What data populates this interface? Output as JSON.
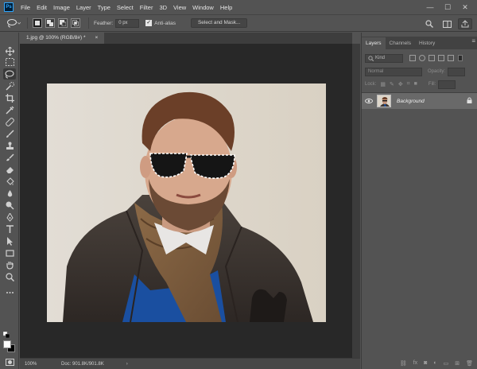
{
  "app": {
    "logo_text": "Ps"
  },
  "menu": [
    "File",
    "Edit",
    "Image",
    "Layer",
    "Type",
    "Select",
    "Filter",
    "3D",
    "View",
    "Window",
    "Help"
  ],
  "window_controls": {
    "minimize": "—",
    "maximize": "☐",
    "close": "✕"
  },
  "options_bar": {
    "tool_icon": "lasso-icon",
    "feather_label": "Feather:",
    "feather_value": "0 px",
    "antialias_label": "Anti-alias",
    "antialias_checked": true,
    "select_mask_label": "Select and Mask..."
  },
  "document": {
    "tab_title": "1.jpg @ 100% (RGB/8#) *",
    "tab_close": "×",
    "zoom": "100%",
    "doc_info": "Doc: 901.8K/901.8K"
  },
  "toolbar": {
    "tools": [
      "move-tool",
      "rect-marquee-tool",
      "lasso-tool",
      "quick-select-tool",
      "crop-tool",
      "eyedropper-tool",
      "healing-tool",
      "brush-tool",
      "clone-stamp-tool",
      "history-brush-tool",
      "eraser-tool",
      "paint-bucket-tool",
      "blur-tool",
      "dodge-tool",
      "pen-tool",
      "type-tool",
      "path-select-tool",
      "rectangle-tool",
      "hand-tool",
      "zoom-tool",
      "more-tools"
    ],
    "active_tool": "lasso-tool",
    "foreground_color": "#ffffff",
    "background_color": "#000000"
  },
  "panels": {
    "tabs": [
      "Layers",
      "Channels",
      "History"
    ],
    "active_tab": "Layers",
    "kind_placeholder": "Kind",
    "blend_mode": "Normal",
    "opacity_label": "Opacity:",
    "lock_label": "Lock:",
    "fill_label": "Fill:",
    "layers": [
      {
        "name": "Background",
        "visible": true,
        "locked": true
      }
    ]
  },
  "colors": {
    "accent": "#31a8ff",
    "chrome": "#535353",
    "canvas_bg": "#282828"
  }
}
